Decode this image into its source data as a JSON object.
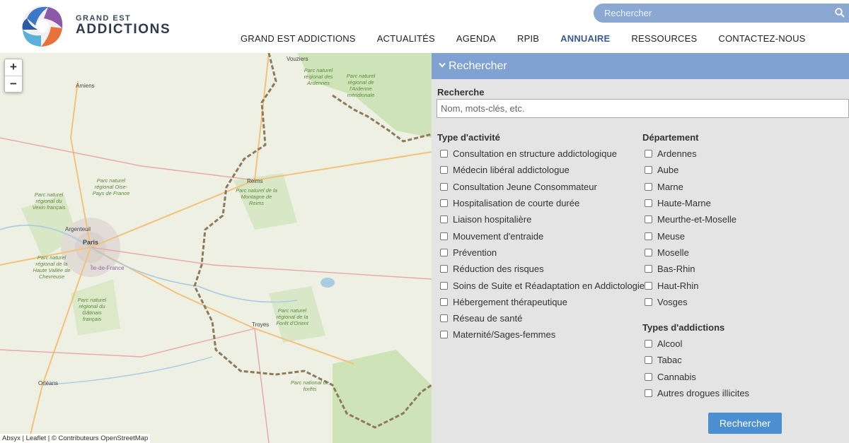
{
  "header": {
    "brand_top": "GRAND EST",
    "brand_main": "ADDICTIONS",
    "search_placeholder": "Rechercher",
    "nav": [
      "GRAND EST ADDICTIONS",
      "ACTUALITÉS",
      "AGENDA",
      "RPIB",
      "ANNUAIRE",
      "RESSOURCES",
      "CONTACTEZ-NOUS"
    ],
    "active_nav": "ANNUAIRE"
  },
  "map": {
    "zoom_in": "+",
    "zoom_out": "−",
    "attribution": "Absyx | Leaflet | © Contributeurs OpenStreetMap",
    "cities": [
      "Amiens",
      "Argenteuil",
      "Paris",
      "Île-de-France",
      "Reims",
      "Troyes",
      "Orléans",
      "Vouziers"
    ],
    "parks": [
      "Parc naturel régional des Ardennes",
      "Parc naturel régional de l'Ardenne méridionale",
      "Parc naturel de la Montagne de Reims",
      "Parc naturel régional Oise-Pays de France",
      "Parc naturel régional du Vexin français",
      "Parc naturel régional de la Haute Vallée de Chevreuse",
      "Parc naturel régional du Gâtinais français",
      "Parc naturel régional de la Forêt d'Orient",
      "Parc national de forêts"
    ]
  },
  "panel": {
    "title": "Rechercher",
    "search_label": "Recherche",
    "search_placeholder": "Nom, mots-clés, etc.",
    "activity_label": "Type d'activité",
    "activities": [
      "Consultation en structure addictologique",
      "Médecin libéral addictologue",
      "Consultation Jeune Consommateur",
      "Hospitalisation de courte durée",
      "Liaison hospitalière",
      "Mouvement d'entraide",
      "Prévention",
      "Réduction des risques",
      "Soins de Suite et Réadaptation en Addictologie",
      "Hébergement thérapeutique",
      "Réseau de santé",
      "Maternité/Sages-femmes"
    ],
    "department_label": "Département",
    "departments": [
      "Ardennes",
      "Aube",
      "Marne",
      "Haute-Marne",
      "Meurthe-et-Moselle",
      "Meuse",
      "Moselle",
      "Bas-Rhin",
      "Haut-Rhin",
      "Vosges"
    ],
    "addiction_label": "Types d'addictions",
    "addictions": [
      "Alcool",
      "Tabac",
      "Cannabis",
      "Autres drogues illicites"
    ],
    "submit": "Rechercher"
  },
  "colors": {
    "accent": "#7fa2d2",
    "nav_active": "#3a5b93",
    "button": "#4c8fd0"
  }
}
